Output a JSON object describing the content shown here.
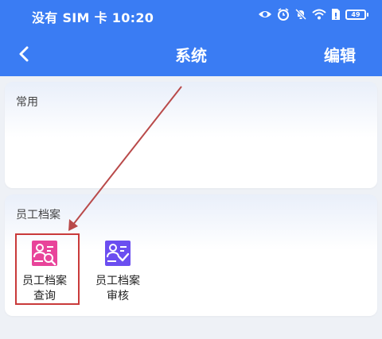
{
  "status_bar": {
    "carrier_time": "没有 SIM 卡 10:20",
    "battery": "49",
    "icons": [
      "eye-icon",
      "alarm-icon",
      "mute-icon",
      "wifi-icon",
      "sim-icon",
      "battery-icon"
    ]
  },
  "navbar": {
    "title": "系统",
    "edit_label": "编辑",
    "back_icon": "chevron-left-icon"
  },
  "sections": {
    "common": {
      "title": "常用"
    },
    "archive": {
      "title": "员工档案",
      "apps": [
        {
          "label_line1": "员工档案",
          "label_line2": "查询",
          "icon": "archive-search-icon",
          "color": "#e8449a"
        },
        {
          "label_line1": "员工档案",
          "label_line2": "审核",
          "icon": "archive-review-icon",
          "color": "#6b4ef0"
        }
      ]
    }
  },
  "colors": {
    "header": "#3a7cf3",
    "annotation": "#c93a3a",
    "background": "#eef1f6"
  }
}
